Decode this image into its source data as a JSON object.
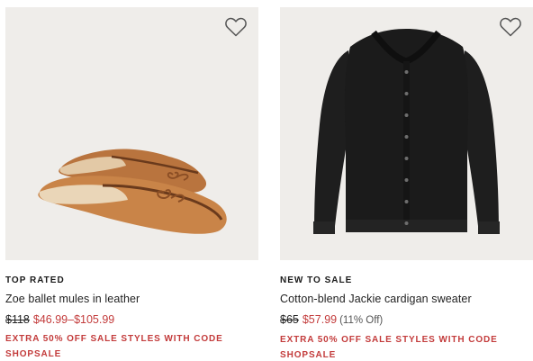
{
  "products": [
    {
      "badge": "TOP RATED",
      "name": "Zoe ballet mules in leather",
      "original_price": "$118",
      "sale_price": "$46.99–$105.99",
      "percent_off": "",
      "promo_line1": "EXTRA 50% OFF SALE STYLES WITH CODE",
      "promo_line2": "SHOPSALE",
      "image": "tan-leather-ballet-mules",
      "favorite_icon": "heart-outline-icon"
    },
    {
      "badge": "NEW TO SALE",
      "name": "Cotton-blend Jackie cardigan sweater",
      "original_price": "$65",
      "sale_price": "$57.99",
      "percent_off": "(11% Off)",
      "promo_line1": "EXTRA 50% OFF SALE STYLES WITH CODE",
      "promo_line2": "SHOPSALE",
      "image": "black-button-cardigan",
      "favorite_icon": "heart-outline-icon"
    }
  ],
  "colors": {
    "sale_red": "#c33b3b",
    "image_bg": "#efedea",
    "text": "#222222"
  }
}
